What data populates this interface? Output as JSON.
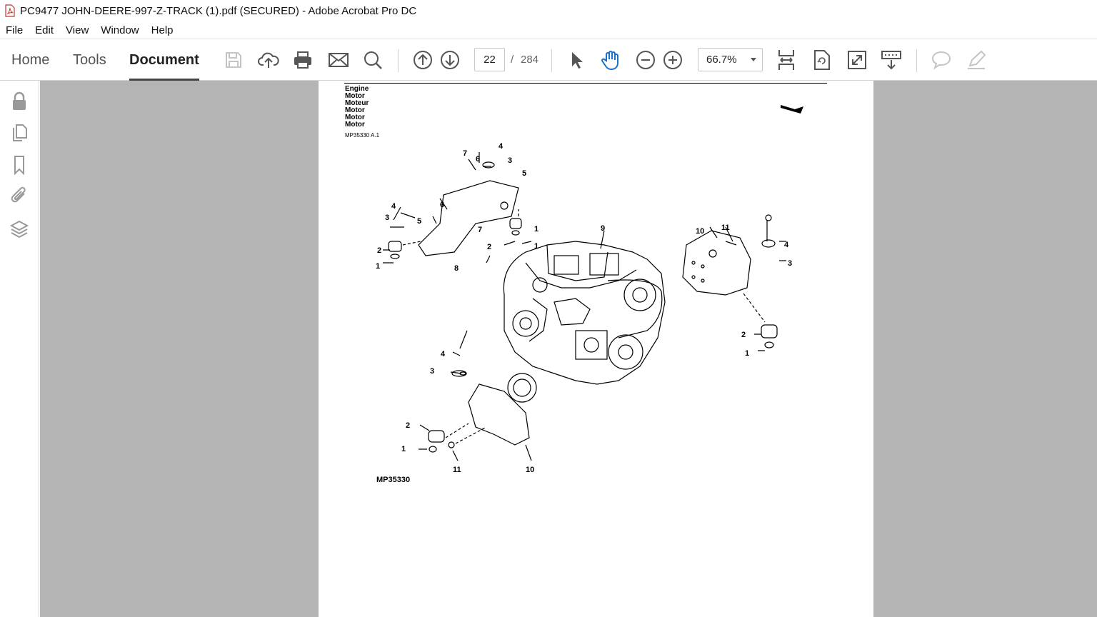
{
  "window": {
    "title": "PC9477 JOHN-DEERE-997-Z-TRACK (1).pdf (SECURED) - Adobe Acrobat Pro DC"
  },
  "menu": [
    "File",
    "Edit",
    "View",
    "Window",
    "Help"
  ],
  "tabs": {
    "home": "Home",
    "tools": "Tools",
    "document": "Document"
  },
  "page_nav": {
    "current": "22",
    "separator": "/",
    "total": "284"
  },
  "zoom": {
    "value": "66.7%"
  },
  "document": {
    "headers": [
      "Engine",
      "Motor",
      "Moteur",
      "Motor",
      "Motor",
      "Motor"
    ],
    "ref": "MP35330 A.1",
    "figure_id": "MP35330",
    "callouts": [
      "1",
      "2",
      "3",
      "4",
      "5",
      "6",
      "7",
      "8",
      "9",
      "10",
      "11"
    ]
  }
}
